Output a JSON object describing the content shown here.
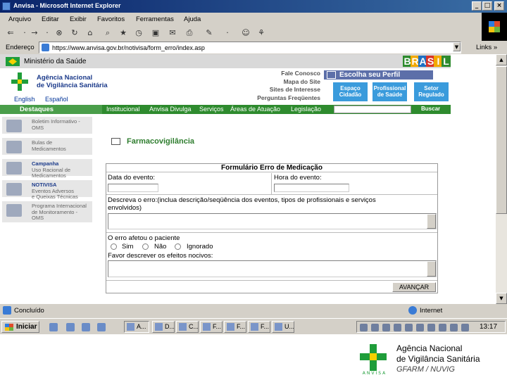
{
  "window": {
    "title": "Anvisa - Microsoft Internet Explorer"
  },
  "menu": [
    "Arquivo",
    "Editar",
    "Exibir",
    "Favoritos",
    "Ferramentas",
    "Ajuda"
  ],
  "address": {
    "label": "Endereço",
    "url": "https://www.anvisa.gov.br/notivisa/form_erro/index.asp",
    "go_label": "Ir",
    "links_label": "Links »"
  },
  "site": {
    "ministry": "Ministério da Saúde",
    "brasil_letters": [
      "B",
      "R",
      "A",
      "S",
      "I",
      "L"
    ],
    "agency_name_line1": "Agência Nacional",
    "agency_name_line2": "de Vigilância Sanitária",
    "languages": [
      "English",
      "Español"
    ],
    "quick_links": [
      "Fale Conosco",
      "Mapa do Site",
      "Sites de Interesse",
      "Perguntas Freqüentes"
    ],
    "perfil": {
      "title": "Escolha seu Perfil",
      "buttons": [
        {
          "line1": "Espaço",
          "line2": "Cidadão"
        },
        {
          "line1": "Profissional",
          "line2": "de Saúde"
        },
        {
          "line1": "Setor",
          "line2": "Regulado"
        }
      ]
    },
    "nav": {
      "destaques": "Destaques",
      "links": [
        "Institucional",
        "Anvisa Divulga",
        "Serviços",
        "Áreas de Atuação",
        "Legislação"
      ],
      "search_button": "Buscar"
    }
  },
  "sidebar": [
    {
      "title": "",
      "text1": "Boletim Informativo -",
      "text2": "OMS",
      "text3": ""
    },
    {
      "title": "",
      "text1": "Bulas de",
      "text2": "Medicamentos",
      "text3": ""
    },
    {
      "title": "Campanha",
      "text1": "Uso Racional de",
      "text2": "Medicamentos",
      "text3": ""
    },
    {
      "title": "NOTIVISA",
      "text1": "Eventos Adversos",
      "text2": "e Queixas Técnicas",
      "text3": ""
    },
    {
      "title": "",
      "text1": "Programa Internacional",
      "text2": "de Monitoramento -",
      "text3": "OMS"
    }
  ],
  "form": {
    "section_title": "Farmacovigilância",
    "title": "Formulário Erro de Medicação",
    "date_label": "Data do evento:",
    "time_label": "Hora do evento:",
    "description_label_line1": "Descreva o erro:(inclua descrição/seqüência dos eventos, tipos de profissionais e serviços",
    "description_label_line2": "envolvidos)",
    "affected_label": "O erro afetou o paciente",
    "options": [
      "Sim",
      "Não",
      "Ignorado"
    ],
    "effects_label": "Favor descrever os efeitos nocivos:",
    "submit_label": "AVANÇAR"
  },
  "status": {
    "text": "Concluído",
    "zone": "Internet"
  },
  "taskbar": {
    "start_label": "Iniciar",
    "tasks": [
      "A...",
      "D...",
      "C...",
      "F...",
      "F...",
      "F...",
      "U..."
    ],
    "clock": "13:17"
  },
  "footer": {
    "line1": "Agência Nacional",
    "line2": "de Vigilância Sanitária",
    "line3": "GFARM / NUVIG",
    "logo_caption": "ANVISA"
  },
  "colors": {
    "titlebar": "#0a246a",
    "anvisa_green": "#2e8b2e",
    "perfil_blue": "#5c6fa9",
    "button_blue": "#3a9bdc"
  }
}
